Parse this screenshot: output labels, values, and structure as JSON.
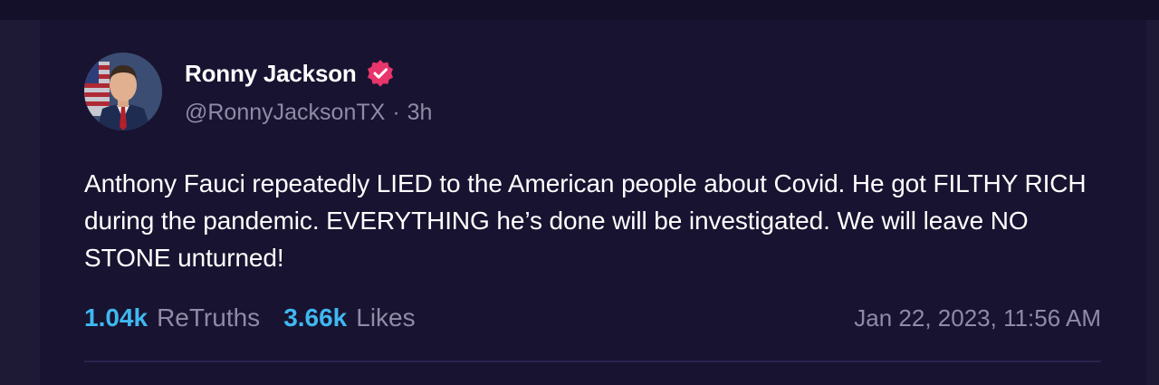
{
  "post": {
    "author": {
      "display_name": "Ronny Jackson",
      "handle": "@RonnyJacksonTX",
      "separator": "·",
      "relative_time": "3h",
      "verified_icon": "verified-badge-icon",
      "verified_color": "#e8356b"
    },
    "text": "Anthony Fauci repeatedly LIED to the American people about Covid. He got FILTHY RICH during the pandemic. EVERYTHING he’s done will be investigated. We will leave NO STONE unturned!",
    "stats": {
      "retruths_count": "1.04k",
      "retruths_label": "ReTruths",
      "likes_count": "3.66k",
      "likes_label": "Likes"
    },
    "timestamp": "Jan 22, 2023, 11:56 AM"
  },
  "colors": {
    "background": "#141029",
    "card": "#181330",
    "accent": "#3fb8f0",
    "muted_text": "#8f8ba6"
  }
}
